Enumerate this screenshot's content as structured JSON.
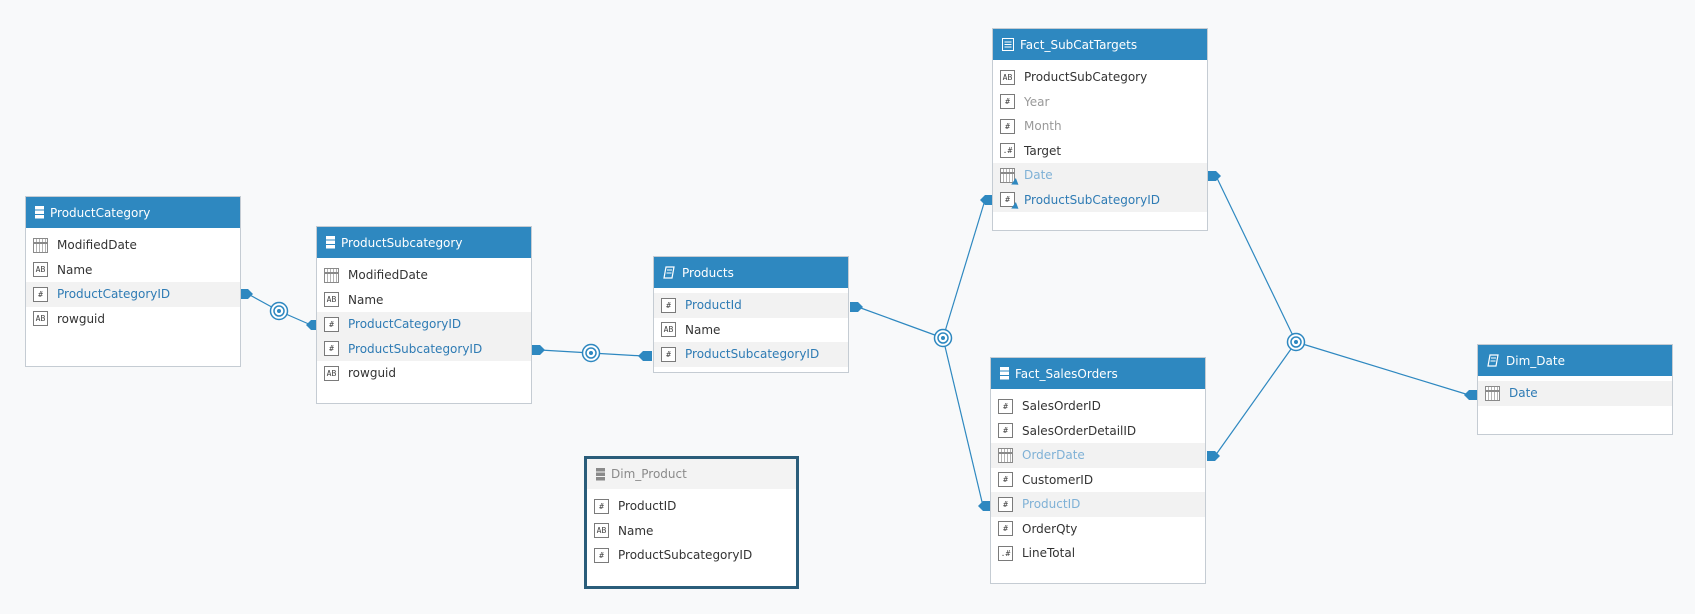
{
  "tables": {
    "product_category": {
      "title": "ProductCategory",
      "columns": [
        {
          "label": "ModifiedDate",
          "icon": "calendar-icon"
        },
        {
          "label": "Name",
          "icon": "text-icon"
        },
        {
          "label": "ProductCategoryID",
          "icon": "number-icon"
        },
        {
          "label": "rowguid",
          "icon": "text-icon"
        }
      ]
    },
    "product_subcategory": {
      "title": "ProductSubcategory",
      "columns": [
        {
          "label": "ModifiedDate",
          "icon": "calendar-icon"
        },
        {
          "label": "Name",
          "icon": "text-icon"
        },
        {
          "label": "ProductCategoryID",
          "icon": "number-icon"
        },
        {
          "label": "ProductSubcategoryID",
          "icon": "number-icon"
        },
        {
          "label": "rowguid",
          "icon": "text-icon"
        }
      ]
    },
    "products": {
      "title": "Products",
      "columns": [
        {
          "label": "ProductId",
          "icon": "number-icon"
        },
        {
          "label": "Name",
          "icon": "text-icon"
        },
        {
          "label": "ProductSubcategoryID",
          "icon": "number-icon"
        }
      ]
    },
    "dim_product": {
      "title": "Dim_Product",
      "columns": [
        {
          "label": "ProductID",
          "icon": "number-icon"
        },
        {
          "label": "Name",
          "icon": "text-icon"
        },
        {
          "label": "ProductSubcategoryID",
          "icon": "number-icon"
        }
      ]
    },
    "fact_subcat_targets": {
      "title": "Fact_SubCatTargets",
      "columns": [
        {
          "label": "ProductSubCategory",
          "icon": "text-icon"
        },
        {
          "label": "Year",
          "icon": "number-icon"
        },
        {
          "label": "Month",
          "icon": "number-icon"
        },
        {
          "label": "Target",
          "icon": "decimal-icon"
        },
        {
          "label": "Date",
          "icon": "calendar-calculated-icon"
        },
        {
          "label": "ProductSubCategoryID",
          "icon": "number-calculated-icon"
        }
      ]
    },
    "fact_sales_orders": {
      "title": "Fact_SalesOrders",
      "columns": [
        {
          "label": "SalesOrderID",
          "icon": "number-icon"
        },
        {
          "label": "SalesOrderDetailID",
          "icon": "number-icon"
        },
        {
          "label": "OrderDate",
          "icon": "calendar-icon"
        },
        {
          "label": "CustomerID",
          "icon": "number-icon"
        },
        {
          "label": "ProductID",
          "icon": "number-icon"
        },
        {
          "label": "OrderQty",
          "icon": "number-icon"
        },
        {
          "label": "LineTotal",
          "icon": "decimal-icon"
        }
      ]
    },
    "dim_date": {
      "title": "Dim_Date",
      "columns": [
        {
          "label": "Date",
          "icon": "calendar-icon"
        }
      ]
    }
  },
  "colors": {
    "header": "#2e88c0",
    "connector": "#2e88c0",
    "key_text": "#2e7bb4",
    "selected_border": "#2a5d7a"
  }
}
